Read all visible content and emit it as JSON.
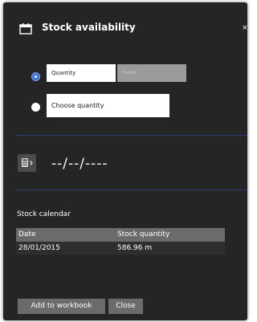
{
  "dialog": {
    "title": "Stock availability",
    "close_symbol": "×",
    "icons": {
      "title": "calendar-icon",
      "date_picker": "calculator-icon"
    },
    "colors": {
      "panel_bg": "#252526",
      "accent": "#3d6fd6",
      "divider": "#2d3d73",
      "button_bg": "#6b6b6b"
    }
  },
  "quantity_option": {
    "selected": true,
    "value": "Quantity",
    "unit": "meter"
  },
  "choose_option": {
    "selected": false,
    "label": "Choose quantity"
  },
  "date": {
    "display": "--/--/----"
  },
  "calendar": {
    "label": "Stock calendar",
    "columns": [
      "Date",
      "Stock quantity"
    ],
    "rows": [
      [
        "28/01/2015",
        "586.96 m"
      ]
    ]
  },
  "buttons": {
    "add_label": "Add to workbook",
    "close_label": "Close"
  }
}
